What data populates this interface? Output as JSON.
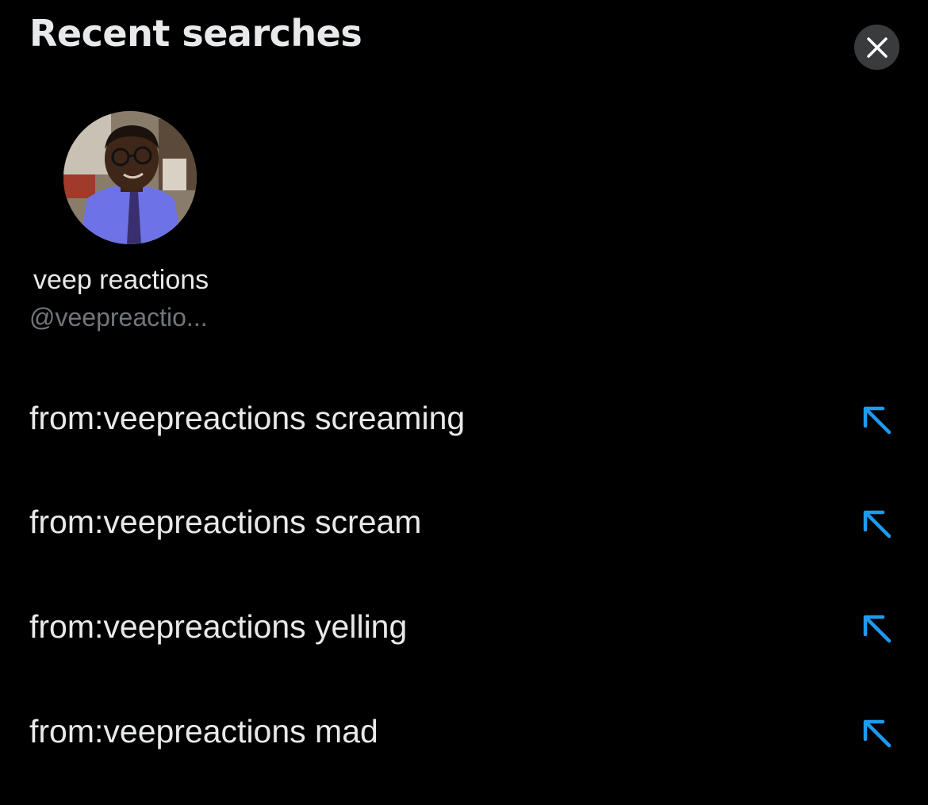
{
  "header": {
    "title": "Recent searches",
    "close_icon": "close-icon"
  },
  "recent_account": {
    "name": "veep reactions",
    "handle": "@veepreactio..."
  },
  "searches": [
    {
      "query": "from:veepreactions screaming",
      "icon": "arrow-up-left-icon"
    },
    {
      "query": "from:veepreactions scream",
      "icon": "arrow-up-left-icon"
    },
    {
      "query": "from:veepreactions yelling",
      "icon": "arrow-up-left-icon"
    },
    {
      "query": "from:veepreactions mad",
      "icon": "arrow-up-left-icon"
    }
  ],
  "colors": {
    "background": "#000000",
    "primary_text": "#e7e9ea",
    "secondary_text": "#71767b",
    "accent": "#1d9bf0",
    "close_button_bg": "#3a3b3d"
  }
}
